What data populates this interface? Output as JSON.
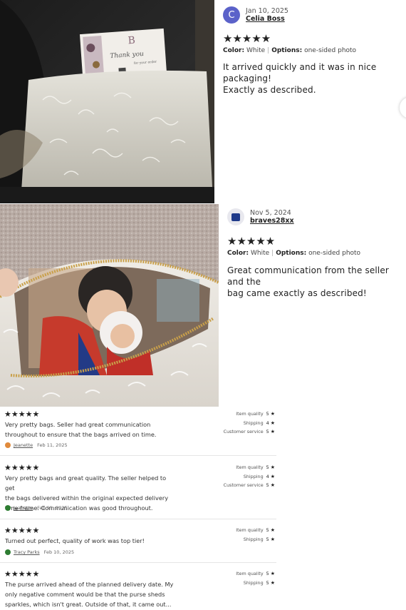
{
  "reviews_with_photos": [
    {
      "avatar_letter": "C",
      "avatar_color": "#5b62c9",
      "date": "Jan 10, 2025",
      "username": "Celia Boss",
      "stars": "★★★★★",
      "color_label": "Color:",
      "color_value": "White",
      "options_label": "Options:",
      "options_value": "one-sided photo",
      "text_lines": [
        "It arrived quickly and it was in nice packaging!",
        "Exactly as described."
      ],
      "card_text": [
        "Thank you",
        "for your order"
      ]
    },
    {
      "avatar_color": "#1f3a8a",
      "date": "Nov 5, 2024",
      "username": "braves28xx",
      "stars": "★★★★★",
      "color_label": "Color:",
      "color_value": "White",
      "options_label": "Options:",
      "options_value": "one-sided photo",
      "text_lines": [
        "Great communication from the seller and the",
        "bag came exactly as described!"
      ]
    }
  ],
  "small_reviews": [
    {
      "stars": "★★★★★",
      "text_lines": [
        "Very pretty bags. Seller had great communication",
        "throughout to ensure that the bags arrived on time."
      ],
      "author": "Jeanette",
      "avatar_color": "#e08a3c",
      "date": "Feb 11, 2025",
      "ratings": [
        {
          "label": "Item quality",
          "value": "5",
          "star": "★"
        },
        {
          "label": "Shipping",
          "value": "4",
          "star": "★"
        },
        {
          "label": "Customer service",
          "value": "5",
          "star": "★"
        }
      ]
    },
    {
      "stars": "★★★★★",
      "text_lines": [
        "Very pretty bags and great quality. The seller helped to get",
        "the bags delivered within the original expected delivery",
        "time frame. Communication was good throughout."
      ],
      "author": "Jeanette",
      "avatar_color": "#2e7d32",
      "date": "Feb 11, 2025",
      "ratings": [
        {
          "label": "Item quality",
          "value": "5",
          "star": "★"
        },
        {
          "label": "Shipping",
          "value": "4",
          "star": "★"
        },
        {
          "label": "Customer service",
          "value": "5",
          "star": "★"
        }
      ]
    },
    {
      "stars": "★★★★★",
      "text_lines": [
        "Turned out perfect, quality of work was top tier!"
      ],
      "author": "Tracy Parks",
      "avatar_color": "#2e7d32",
      "date": "Feb 10, 2025",
      "ratings": [
        {
          "label": "Item quality",
          "value": "5",
          "star": "★"
        },
        {
          "label": "Shipping",
          "value": "5",
          "star": "★"
        }
      ]
    },
    {
      "stars": "★★★★★",
      "text_lines": [
        "The purse arrived ahead of the planned delivery date. My",
        "only negative comment would be that the purse sheds",
        "sparkles, which isn't great. Outside of that, it came out..."
      ],
      "ratings": [
        {
          "label": "Item quality",
          "value": "5",
          "star": "★"
        },
        {
          "label": "Shipping",
          "value": "5",
          "star": "★"
        }
      ]
    }
  ]
}
